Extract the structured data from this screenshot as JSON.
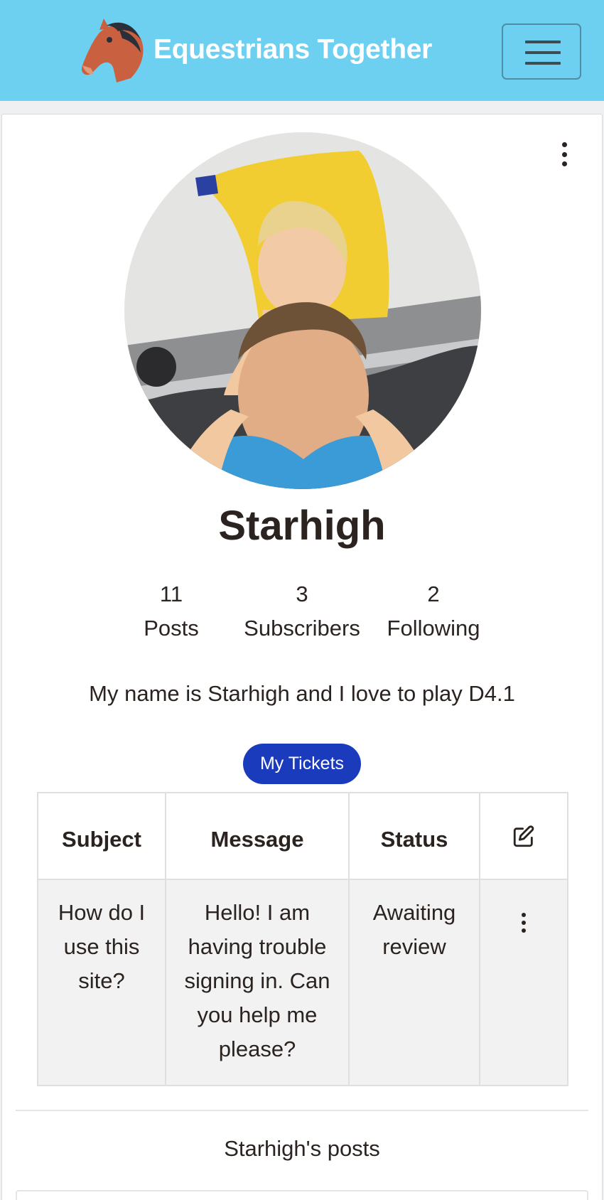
{
  "app": {
    "title": "Equestrians Together",
    "logo_icon": "horse-head-icon",
    "menu_icon": "hamburger-menu-icon",
    "brand_color": "#6dd0f1"
  },
  "profile": {
    "username": "Starhigh",
    "avatar_alt": "profile photo",
    "options_icon": "kebab-menu-icon",
    "stats": [
      {
        "value": "11",
        "label": "Posts"
      },
      {
        "value": "3",
        "label": "Subscribers"
      },
      {
        "value": "2",
        "label": "Following"
      }
    ],
    "bio": "My name is Starhigh and I love to play D4.1"
  },
  "tickets": {
    "button_label": "My Tickets",
    "button_color": "#1b3bbd",
    "columns": [
      "Subject",
      "Message",
      "Status"
    ],
    "edit_icon": "edit-icon",
    "rows": [
      {
        "subject": "How do I use this site?",
        "message": "Hello! I am having trouble signing in. Can you help me please?",
        "status": "Awaiting review",
        "actions_icon": "kebab-menu-icon"
      }
    ]
  },
  "posts": {
    "title": "Starhigh's posts"
  }
}
